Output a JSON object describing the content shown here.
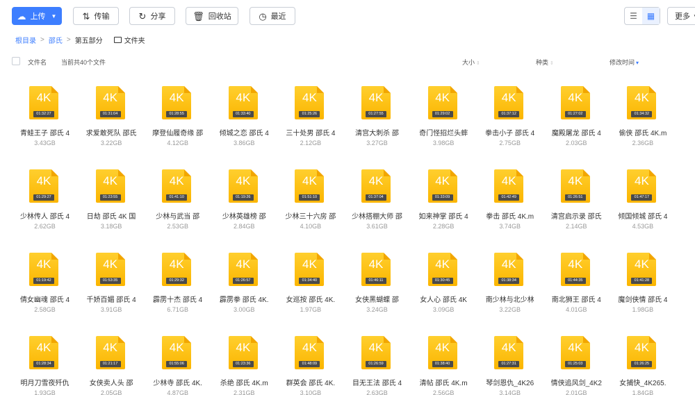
{
  "toolbar": {
    "upload_label": "上传",
    "transfer_label": "传输",
    "share_label": "分享",
    "recycle_label": "回收站",
    "recent_label": "最近",
    "more_label": "更多"
  },
  "breadcrumb": {
    "items": [
      "根目录",
      "邵氏",
      "第五部分"
    ],
    "folder_label": "文件夹"
  },
  "header": {
    "name_label": "文件名",
    "count_label": "当前共40个文件",
    "size_label": "大小",
    "type_label": "种类",
    "time_label": "修改时间"
  },
  "thumb_label": "4K",
  "files": [
    {
      "name": "青蛙王子 邵氏 4",
      "size": "3.43GB",
      "duration": "01:32:27"
    },
    {
      "name": "求爱敢死队 邵氏",
      "size": "3.22GB",
      "duration": "01:31:04"
    },
    {
      "name": "摩登仙履奇缘 邵",
      "size": "4.12GB",
      "duration": "01:28:55"
    },
    {
      "name": "倾城之恋 邵氏 4",
      "size": "3.86GB",
      "duration": "01:33:40"
    },
    {
      "name": "三十处男 邵氏 4",
      "size": "2.12GB",
      "duration": "01:25:26"
    },
    {
      "name": "清宫大刺杀 邵",
      "size": "3.27GB",
      "duration": "01:27:55"
    },
    {
      "name": "奇门怪招烂头蟀",
      "size": "3.98GB",
      "duration": "01:29:02"
    },
    {
      "name": "拳击小子 邵氏 4",
      "size": "2.75GB",
      "duration": "01:37:12"
    },
    {
      "name": "魔殿屠龙 邵氏 4",
      "size": "2.03GB",
      "duration": "01:27:02"
    },
    {
      "name": "偷侠 邵氏 4K.m",
      "size": "2.36GB",
      "duration": "01:34:32"
    },
    {
      "name": "少林传人 邵氏 4",
      "size": "2.62GB",
      "duration": "01:29:27"
    },
    {
      "name": "日劫 邵氏 4K 国",
      "size": "3.18GB",
      "duration": "01:23:55"
    },
    {
      "name": "少林与武当 邵",
      "size": "2.53GB",
      "duration": "01:41:10"
    },
    {
      "name": "少林英雄榜 邵",
      "size": "2.84GB",
      "duration": "01:19:26"
    },
    {
      "name": "少林三十六房 邵",
      "size": "4.10GB",
      "duration": "01:51:10"
    },
    {
      "name": "少林搭棚大师 邵",
      "size": "3.61GB",
      "duration": "01:37:04"
    },
    {
      "name": "如来神掌 邵氏 4",
      "size": "2.28GB",
      "duration": "01:33:09"
    },
    {
      "name": "拳击 邵氏 4K.m",
      "size": "3.74GB",
      "duration": "01:42:49"
    },
    {
      "name": "清宫启示录 邵氏",
      "size": "2.14GB",
      "duration": "01:26:51"
    },
    {
      "name": "倾国倾城 邵氏 4",
      "size": "4.53GB",
      "duration": "01:47:17"
    },
    {
      "name": "倩女幽魂 邵氏 4",
      "size": "2.58GB",
      "duration": "01:19:42"
    },
    {
      "name": "千娇百媚 邵氏 4",
      "size": "3.91GB",
      "duration": "01:53:35"
    },
    {
      "name": "霹雳十杰 邵氏 4",
      "size": "6.71GB",
      "duration": "01:29:32"
    },
    {
      "name": "霹雳拳 邵氏 4K.",
      "size": "3.00GB",
      "duration": "01:26:57"
    },
    {
      "name": "女巡按 邵氏 4K.",
      "size": "1.97GB",
      "duration": "01:34:40"
    },
    {
      "name": "女侠黑蝴蝶 邵",
      "size": "3.24GB",
      "duration": "01:46:11"
    },
    {
      "name": "女人心 邵氏 4K",
      "size": "3.09GB",
      "duration": "01:30:45"
    },
    {
      "name": "南少林与北少林",
      "size": "3.22GB",
      "duration": "01:38:34"
    },
    {
      "name": "南北狮王 邵氏 4",
      "size": "4.01GB",
      "duration": "01:44:35"
    },
    {
      "name": "魔剑侠情 邵氏 4",
      "size": "1.98GB",
      "duration": "01:41:28"
    },
    {
      "name": "明月刀雪夜歼仇",
      "size": "1.93GB",
      "duration": "01:28:34"
    },
    {
      "name": "女侠卖人头 邵",
      "size": "2.05GB",
      "duration": "01:21:17"
    },
    {
      "name": "少林寺 邵氏 4K.",
      "size": "4.87GB",
      "duration": "01:55:06"
    },
    {
      "name": "杀绝 邵氏 4K.m",
      "size": "2.31GB",
      "duration": "01:23:36"
    },
    {
      "name": "群英会 邵氏 4K.",
      "size": "3.10GB",
      "duration": "01:48:09"
    },
    {
      "name": "目无王法 邵氏 4",
      "size": "2.63GB",
      "duration": "01:26:59"
    },
    {
      "name": "清帖 邵氏 4K.m",
      "size": "2.56GB",
      "duration": "01:38:40"
    },
    {
      "name": "琴剑恩仇_4K26",
      "size": "3.14GB",
      "duration": "01:27:31"
    },
    {
      "name": "情侠追风剑_4K2",
      "size": "2.01GB",
      "duration": "01:25:03"
    },
    {
      "name": "女捕快_4K265.",
      "size": "1.84GB",
      "duration": "01:26:25"
    }
  ]
}
